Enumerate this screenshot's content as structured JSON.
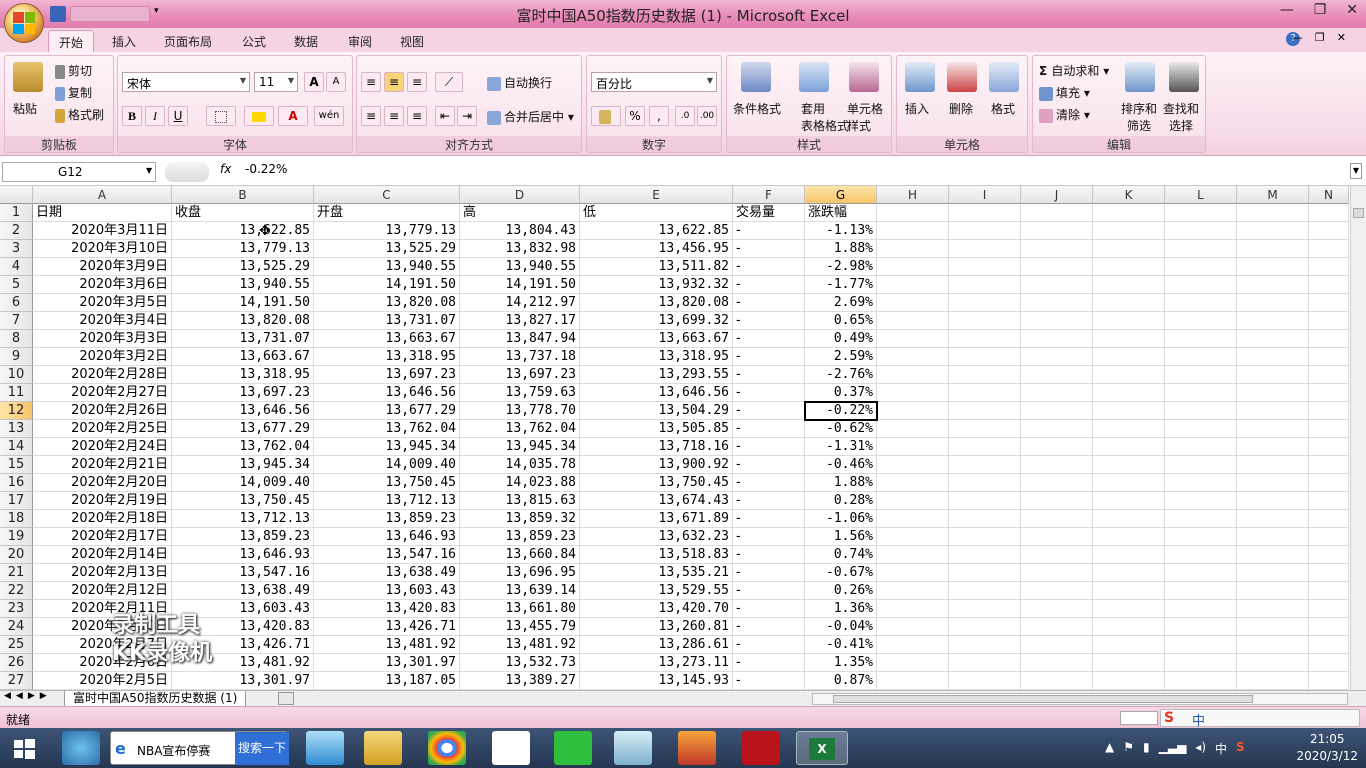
{
  "app": {
    "title": "富时中国A50指数历史数据 (1) - Microsoft Excel",
    "controls": [
      "—",
      "❐",
      "✕"
    ]
  },
  "tabs": [
    "开始",
    "插入",
    "页面布局",
    "公式",
    "数据",
    "审阅",
    "视图"
  ],
  "ribbon": {
    "clipboard": {
      "label": "剪贴板",
      "paste": "粘贴",
      "cut": "剪切",
      "copy": "复制",
      "format_painter": "格式刷"
    },
    "font": {
      "label": "字体",
      "name": "宋体",
      "size": "11",
      "bold": "B",
      "italic": "I",
      "underline": "U",
      "grow": "A",
      "shrink": "A"
    },
    "alignment": {
      "label": "对齐方式",
      "wrap": "自动换行",
      "merge": "合并后居中"
    },
    "number": {
      "label": "数字",
      "format": "百分比",
      "percent": "%",
      "comma": ","
    },
    "styles": {
      "label": "样式",
      "conditional": "条件格式",
      "table1": "套用",
      "table2": "表格格式",
      "cell1": "单元格",
      "cell2": "样式"
    },
    "cells": {
      "label": "单元格",
      "insert": "插入",
      "delete": "删除",
      "format": "格式"
    },
    "editing": {
      "label": "编辑",
      "autosum": "自动求和",
      "fill": "填充",
      "clear": "清除",
      "sort1": "排序和",
      "sort2": "筛选",
      "find1": "查找和",
      "find2": "选择"
    }
  },
  "formula": {
    "namebox": "G12",
    "fx": "fx",
    "value": "-0.22%"
  },
  "columns": [
    "A",
    "B",
    "C",
    "D",
    "E",
    "F",
    "G",
    "H",
    "I",
    "J",
    "K",
    "L",
    "M",
    "N"
  ],
  "headers": [
    "日期",
    "收盘",
    "开盘",
    "高",
    "低",
    "交易量",
    "涨跌幅"
  ],
  "rows": [
    [
      "2020年3月11日",
      "13,622.85",
      "13,779.13",
      "13,804.43",
      "13,622.85",
      "-",
      "-1.13%"
    ],
    [
      "2020年3月10日",
      "13,779.13",
      "13,525.29",
      "13,832.98",
      "13,456.95",
      "-",
      "1.88%"
    ],
    [
      "2020年3月9日",
      "13,525.29",
      "13,940.55",
      "13,940.55",
      "13,511.82",
      "-",
      "-2.98%"
    ],
    [
      "2020年3月6日",
      "13,940.55",
      "14,191.50",
      "14,191.50",
      "13,932.32",
      "-",
      "-1.77%"
    ],
    [
      "2020年3月5日",
      "14,191.50",
      "13,820.08",
      "14,212.97",
      "13,820.08",
      "-",
      "2.69%"
    ],
    [
      "2020年3月4日",
      "13,820.08",
      "13,731.07",
      "13,827.17",
      "13,699.32",
      "-",
      "0.65%"
    ],
    [
      "2020年3月3日",
      "13,731.07",
      "13,663.67",
      "13,847.94",
      "13,663.67",
      "-",
      "0.49%"
    ],
    [
      "2020年3月2日",
      "13,663.67",
      "13,318.95",
      "13,737.18",
      "13,318.95",
      "-",
      "2.59%"
    ],
    [
      "2020年2月28日",
      "13,318.95",
      "13,697.23",
      "13,697.23",
      "13,293.55",
      "-",
      "-2.76%"
    ],
    [
      "2020年2月27日",
      "13,697.23",
      "13,646.56",
      "13,759.63",
      "13,646.56",
      "-",
      "0.37%"
    ],
    [
      "2020年2月26日",
      "13,646.56",
      "13,677.29",
      "13,778.70",
      "13,504.29",
      "-",
      "-0.22%"
    ],
    [
      "2020年2月25日",
      "13,677.29",
      "13,762.04",
      "13,762.04",
      "13,505.85",
      "-",
      "-0.62%"
    ],
    [
      "2020年2月24日",
      "13,762.04",
      "13,945.34",
      "13,945.34",
      "13,718.16",
      "-",
      "-1.31%"
    ],
    [
      "2020年2月21日",
      "13,945.34",
      "14,009.40",
      "14,035.78",
      "13,900.92",
      "-",
      "-0.46%"
    ],
    [
      "2020年2月20日",
      "14,009.40",
      "13,750.45",
      "14,023.88",
      "13,750.45",
      "-",
      "1.88%"
    ],
    [
      "2020年2月19日",
      "13,750.45",
      "13,712.13",
      "13,815.63",
      "13,674.43",
      "-",
      "0.28%"
    ],
    [
      "2020年2月18日",
      "13,712.13",
      "13,859.23",
      "13,859.32",
      "13,671.89",
      "-",
      "-1.06%"
    ],
    [
      "2020年2月17日",
      "13,859.23",
      "13,646.93",
      "13,859.23",
      "13,632.23",
      "-",
      "1.56%"
    ],
    [
      "2020年2月14日",
      "13,646.93",
      "13,547.16",
      "13,660.84",
      "13,518.83",
      "-",
      "0.74%"
    ],
    [
      "2020年2月13日",
      "13,547.16",
      "13,638.49",
      "13,696.95",
      "13,535.21",
      "-",
      "-0.67%"
    ],
    [
      "2020年2月12日",
      "13,638.49",
      "13,603.43",
      "13,639.14",
      "13,529.55",
      "-",
      "0.26%"
    ],
    [
      "2020年2月11日",
      "13,603.43",
      "13,420.83",
      "13,661.80",
      "13,420.70",
      "-",
      "1.36%"
    ],
    [
      "2020年2月10日",
      "13,420.83",
      "13,426.71",
      "13,455.79",
      "13,260.81",
      "-",
      "-0.04%"
    ],
    [
      "2020年2月7日",
      "13,426.71",
      "13,481.92",
      "13,481.92",
      "13,286.61",
      "-",
      "-0.41%"
    ],
    [
      "2020年2月6日",
      "13,481.92",
      "13,301.97",
      "13,532.73",
      "13,273.11",
      "-",
      "1.35%"
    ],
    [
      "2020年2月5日",
      "13,301.97",
      "13,187.05",
      "13,389.27",
      "13,145.93",
      "-",
      "0.87%"
    ]
  ],
  "sheet": {
    "tab": "富时中国A50指数历史数据 (1)"
  },
  "status": {
    "text": "就绪"
  },
  "watermark": {
    "line1": "录制工具",
    "line2": "KK录像机"
  },
  "taskbar": {
    "ie_label": "NBA宣布停赛",
    "search_label": "搜索一下",
    "time": "21:05",
    "date": "2020/3/12",
    "ime": "中"
  }
}
